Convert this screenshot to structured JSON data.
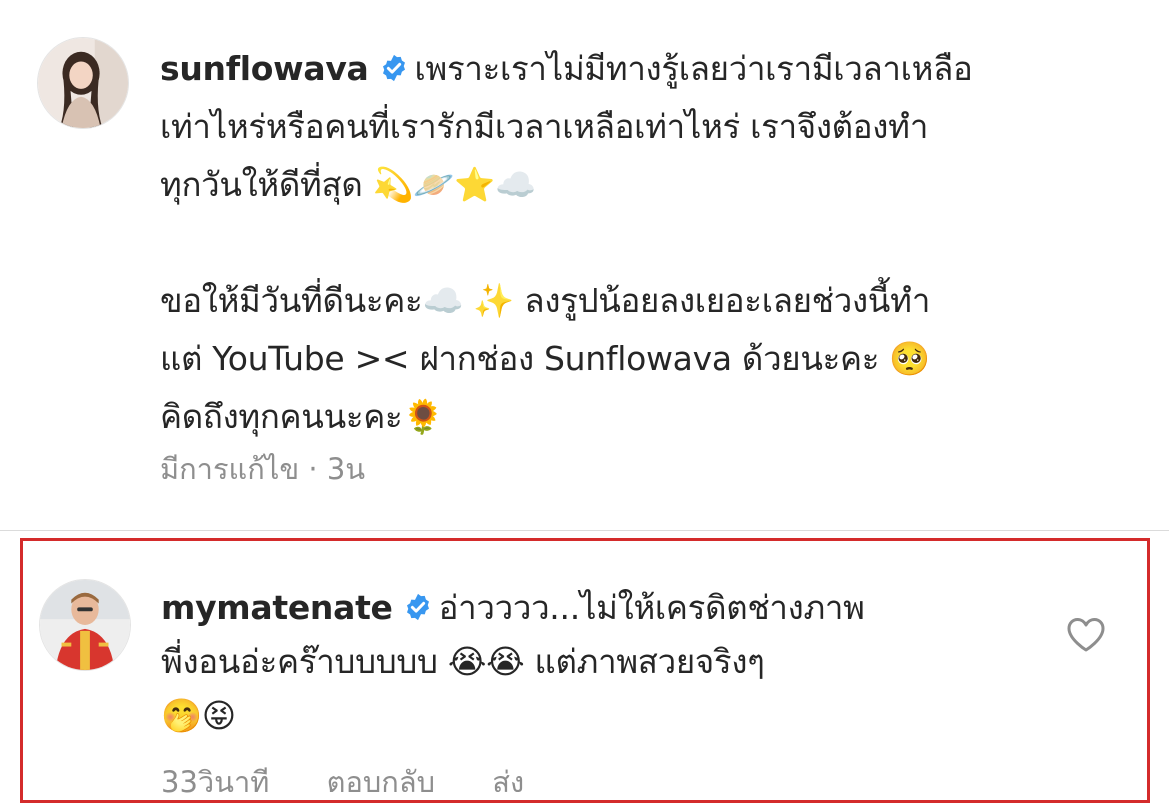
{
  "post": {
    "username": "sunflowava",
    "caption_line1": "เพราะเราไม่มีทางรู้เลยว่าเรามีเวลาเหลือ",
    "caption_line2": "เท่าไหร่หรือคนที่เรารักมีเวลาเหลือเท่าไหร่  เราจึงต้องทำ",
    "caption_line3": "ทุกวันให้ดีที่สุด 💫🪐⭐️☁️",
    "caption_line4": "ขอให้มีวันที่ดีนะคะ☁️ ✨ ลงรูปน้อยลงเยอะเลยช่วงนี้ทำ",
    "caption_line5": "แต่ YouTube >< ฝากช่อง Sunflowava ด้วยนะคะ 🥺",
    "caption_line6": "คิดถึงทุกคนนะคะ🌻",
    "meta": "มีการแก้ไข · 3น"
  },
  "reply": {
    "username": "mymatenate",
    "text_line1": "อ่าวววว...ไม่ให้เครดิตช่างภาพ",
    "text_line2": "พี่งอนอ่ะคร๊าบบบบบ 😭😭 แต่ภาพสวยจริงๆ",
    "text_line3": "🤭😝",
    "time": "33วินาที",
    "reply_label": "ตอบกลับ",
    "send_label": "ส่ง"
  },
  "colors": {
    "verified": "#3897f0",
    "highlight_border": "#d42b2b",
    "muted_text": "#8e8e8e"
  },
  "icons": {
    "verified": "verified-badge-icon",
    "like": "heart-outline-icon"
  }
}
